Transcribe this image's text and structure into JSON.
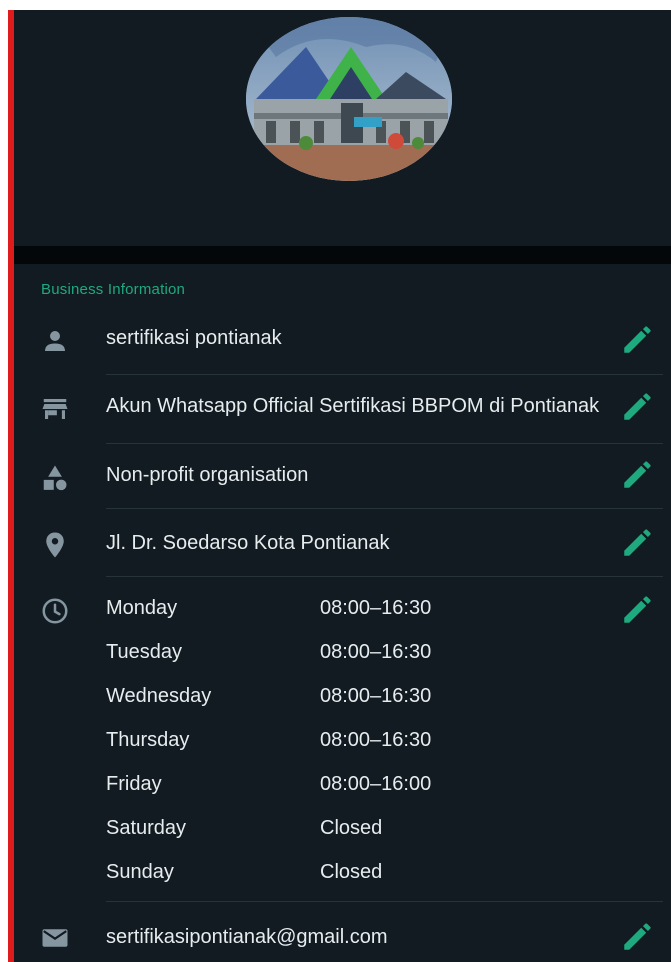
{
  "profile": {
    "photo_alt": "business profile photo"
  },
  "section": {
    "title": "Business Information"
  },
  "rows": {
    "name": {
      "text": "sertifikasi pontianak",
      "icon": "person-icon"
    },
    "description": {
      "text": "Akun Whatsapp Official Sertifikasi BBPOM di Pontianak",
      "icon": "store-icon"
    },
    "category": {
      "text": "Non-profit organisation",
      "icon": "category-icon"
    },
    "address": {
      "text": "Jl. Dr. Soedarso Kota Pontianak",
      "icon": "location-pin-icon"
    },
    "email": {
      "text": "sertifikasipontianak@gmail.com",
      "icon": "mail-icon"
    }
  },
  "hours": [
    {
      "day": "Monday",
      "time": "08:00–16:30"
    },
    {
      "day": "Tuesday",
      "time": "08:00–16:30"
    },
    {
      "day": "Wednesday",
      "time": "08:00–16:30"
    },
    {
      "day": "Thursday",
      "time": "08:00–16:30"
    },
    {
      "day": "Friday",
      "time": "08:00–16:00"
    },
    {
      "day": "Saturday",
      "time": "Closed"
    },
    {
      "day": "Sunday",
      "time": "Closed"
    }
  ],
  "colors": {
    "background": "#111b21",
    "accent": "#1fa97f",
    "icon_gray": "#8696a0",
    "text": "#e7ecee",
    "border_red": "#e01b1b"
  }
}
